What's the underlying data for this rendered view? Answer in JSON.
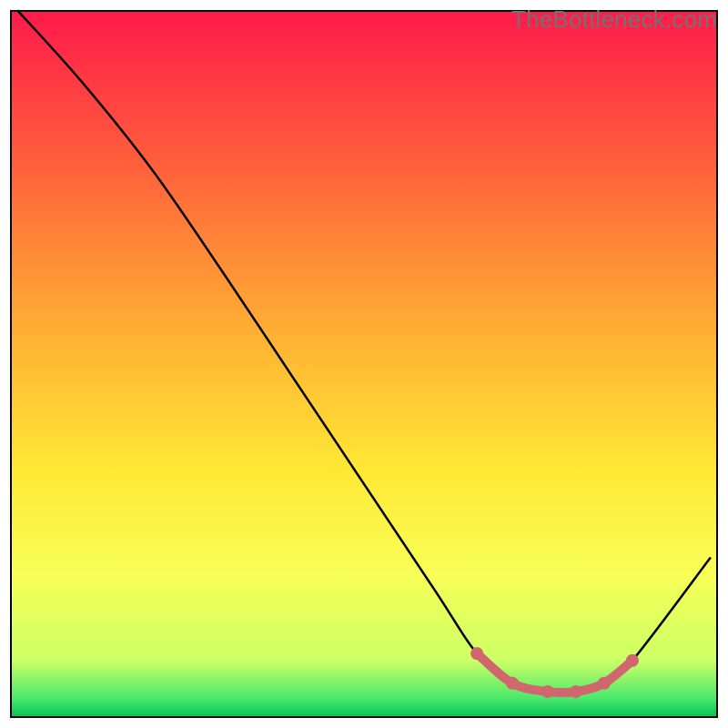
{
  "watermark": "TheBottleneck.com",
  "chart_data": {
    "type": "line",
    "title": "",
    "xlabel": "",
    "ylabel": "",
    "xlim": [
      0,
      100
    ],
    "ylim": [
      0,
      100
    ],
    "gradient_stops": [
      {
        "offset": 0.0,
        "color": "#ff1a4b"
      },
      {
        "offset": 0.2,
        "color": "#ff5a3c"
      },
      {
        "offset": 0.45,
        "color": "#ffae33"
      },
      {
        "offset": 0.65,
        "color": "#ffe834"
      },
      {
        "offset": 0.8,
        "color": "#f8ff57"
      },
      {
        "offset": 0.92,
        "color": "#ccff66"
      },
      {
        "offset": 0.975,
        "color": "#47e86b"
      },
      {
        "offset": 1.0,
        "color": "#00c455"
      }
    ],
    "series": [
      {
        "name": "curve",
        "points": [
          {
            "x": 1.0,
            "y": 100.0
          },
          {
            "x": 10.0,
            "y": 90.0
          },
          {
            "x": 20.0,
            "y": 77.5
          },
          {
            "x": 30.0,
            "y": 63.0
          },
          {
            "x": 40.0,
            "y": 48.0
          },
          {
            "x": 50.0,
            "y": 33.0
          },
          {
            "x": 60.0,
            "y": 18.0
          },
          {
            "x": 66.0,
            "y": 9.0
          },
          {
            "x": 71.0,
            "y": 4.8
          },
          {
            "x": 76.0,
            "y": 3.6
          },
          {
            "x": 80.0,
            "y": 3.6
          },
          {
            "x": 84.0,
            "y": 4.8
          },
          {
            "x": 88.0,
            "y": 8.0
          },
          {
            "x": 99.0,
            "y": 22.5
          }
        ]
      }
    ],
    "highlight": {
      "name": "minimum-region",
      "x_range": [
        66.0,
        88.0
      ],
      "color": "#d1676e"
    }
  }
}
